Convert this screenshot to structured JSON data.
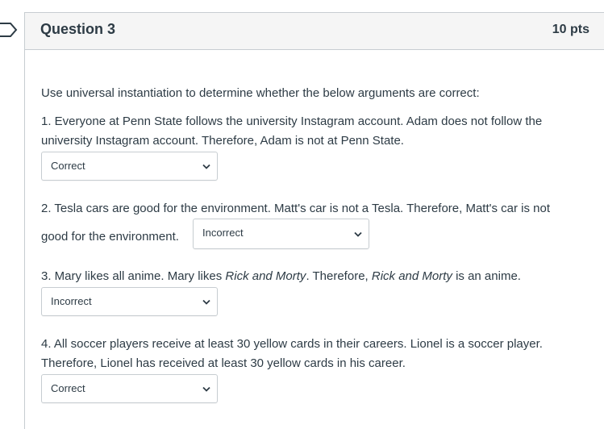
{
  "question": {
    "title": "Question 3",
    "points": "10 pts",
    "intro": "Use universal instantiation to determine whether the below arguments are correct:"
  },
  "items": [
    {
      "line1": "1. Everyone at Penn State follows the university Instagram account. Adam does not follow the",
      "line2": "university Instagram account. Therefore, Adam is not at Penn State.",
      "selected": "Correct"
    },
    {
      "line1": "2. Tesla cars are good for the environment. Matt's car is not a Tesla. Therefore, Matt's car is not",
      "line2": "good for the environment.",
      "selected": "Incorrect"
    },
    {
      "line1_a": "3. Mary likes all anime. Mary likes ",
      "line1_b": "Rick and Morty",
      "line1_c": ". Therefore, ",
      "line1_d": "Rick and Morty",
      "line1_e": " is an anime.",
      "selected": "Incorrect"
    },
    {
      "line1": "4. All soccer players receive at least 30 yellow cards in their careers. Lionel is a soccer player.",
      "line2": "Therefore, Lionel has received at least 30 yellow cards in his career.",
      "selected": "Correct"
    }
  ],
  "icons": {
    "flag": "bookmark-flag-icon",
    "dropdown": "chevron-down-icon"
  },
  "colors": {
    "text": "#2d3b45",
    "border": "#c7cdd1",
    "header_bg": "#f5f5f5"
  }
}
